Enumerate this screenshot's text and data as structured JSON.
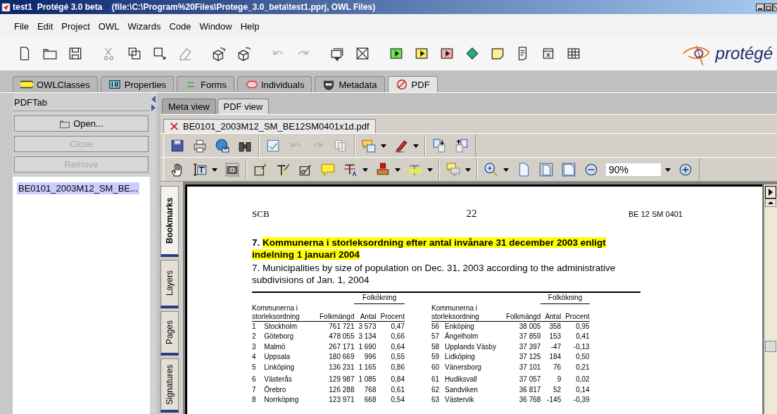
{
  "window": {
    "title": "test1  Protégé 3.0 beta    (file:\\C:\\Program%20Files\\Protege_3.0_beta\\test1.pprj, OWL Files)"
  },
  "menu": [
    "File",
    "Edit",
    "Project",
    "OWL",
    "Wizards",
    "Code",
    "Window",
    "Help"
  ],
  "logo": {
    "text": "protégé"
  },
  "main_tabs": [
    {
      "label": "OWLClasses",
      "selected": false
    },
    {
      "label": "Properties",
      "selected": false
    },
    {
      "label": "Forms",
      "selected": false
    },
    {
      "label": "Individuals",
      "selected": false
    },
    {
      "label": "Metadata",
      "selected": false
    },
    {
      "label": "PDF",
      "selected": true
    }
  ],
  "left_panel": {
    "title": "PDFTab",
    "buttons": [
      {
        "label": "Open...",
        "disabled": false
      },
      {
        "label": "Close",
        "disabled": true
      },
      {
        "label": "Remove",
        "disabled": true
      }
    ],
    "files": [
      {
        "label": "BE0101_2003M12_SM_BE...",
        "selected": true
      }
    ]
  },
  "view_tabs": [
    {
      "label": "Meta view",
      "selected": false
    },
    {
      "label": "PDF view",
      "selected": true
    }
  ],
  "document_tab": {
    "label": "BE0101_2003M12_SM_BE12SM0401x1d.pdf"
  },
  "zoom": {
    "value": "90%"
  },
  "side_tabs": [
    {
      "label": "Bookmarks",
      "selected": true
    },
    {
      "label": "Layers",
      "selected": false
    },
    {
      "label": "Pages",
      "selected": false
    },
    {
      "label": "Signatures",
      "selected": false
    }
  ],
  "pdf_page": {
    "header_left": "SCB",
    "header_center": "22",
    "header_right": "BE 12 SM 0401",
    "title_number": "7.",
    "title": "Kommunerna i storleksordning efter antal invånare 31 december 2003 enligt indelning 1 januari 2004",
    "subtitle": "7. Municipalities by size of population on Dec. 31, 2003 according to the administrative subdivisions of Jan. 1, 2004",
    "table_halves": [
      {
        "group_header": "Folkökning",
        "columns": [
          "Kommunerna i storleksordning",
          "Folkmängd",
          "Antal",
          "Procent"
        ],
        "blocks": [
          [
            [
              "1",
              "Stockholm",
              "761 721",
              "3 573",
              "0,47"
            ],
            [
              "2",
              "Göteborg",
              "478 055",
              "3 134",
              "0,66"
            ],
            [
              "3",
              "Malmö",
              "267 171",
              "1 690",
              "0,64"
            ],
            [
              "4",
              "Uppsala",
              "180 669",
              "996",
              "0,55"
            ],
            [
              "5",
              "Linköping",
              "136 231",
              "1 165",
              "0,86"
            ]
          ],
          [
            [
              "6",
              "Västerås",
              "129 987",
              "1 085",
              "0,84"
            ],
            [
              "7",
              "Örebro",
              "126 288",
              "768",
              "0,61"
            ],
            [
              "8",
              "Norrköping",
              "123 971",
              "668",
              "0,54"
            ]
          ]
        ]
      },
      {
        "group_header": "Folkökning",
        "columns": [
          "Kommunerna i storleksordning",
          "Folkmängd",
          "Antal",
          "Procent"
        ],
        "blocks": [
          [
            [
              "56",
              "Enköping",
              "38 005",
              "358",
              "0,95"
            ],
            [
              "57",
              "Ängelholm",
              "37 859",
              "153",
              "0,41"
            ],
            [
              "58",
              "Upplands Väsby",
              "37 397",
              "-47",
              "-0,13"
            ],
            [
              "59",
              "Lidköping",
              "37 125",
              "184",
              "0,50"
            ],
            [
              "60",
              "Vänersborg",
              "37 101",
              "76",
              "0,21"
            ]
          ],
          [
            [
              "61",
              "Hudiksvall",
              "37 057",
              "9",
              "0,02"
            ],
            [
              "62",
              "Sandviken",
              "36 817",
              "52",
              "0,14"
            ],
            [
              "63",
              "Västervik",
              "36 768",
              "-145",
              "-0,39"
            ]
          ]
        ]
      }
    ]
  }
}
